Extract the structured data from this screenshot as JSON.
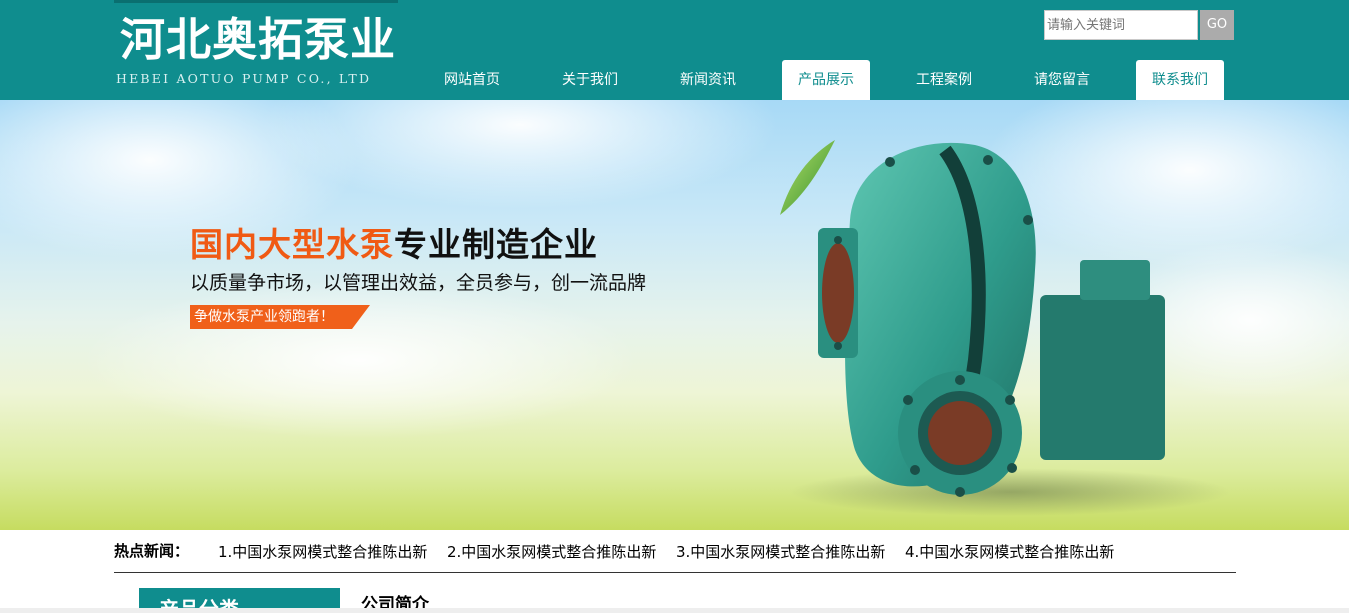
{
  "logo": {
    "title": "河北奥拓泵业",
    "subtitle": "HEBEI AOTUO PUMP CO., LTD"
  },
  "search": {
    "placeholder": "请输入关键词",
    "button_label": "GO"
  },
  "nav": {
    "items": [
      {
        "label": "网站首页",
        "active": false
      },
      {
        "label": "关于我们",
        "active": false
      },
      {
        "label": "新闻资讯",
        "active": false
      },
      {
        "label": "产品展示",
        "active": true
      },
      {
        "label": "工程案例",
        "active": false
      },
      {
        "label": "请您留言",
        "active": false
      },
      {
        "label": "联系我们",
        "active": true
      }
    ]
  },
  "banner": {
    "headline_accent": "国内大型水泵",
    "headline_rest": "专业制造企业",
    "slogan": "以质量争市场，以管理出效益，全员参与，创一流品牌",
    "tag": "争做水泵产业领跑者！"
  },
  "hot_news": {
    "label": "热点新闻：",
    "items": [
      "1.中国水泵网模式整合推陈出新",
      "2.中国水泵网模式整合推陈出新",
      "3.中国水泵网模式整合推陈出新",
      "4.中国水泵网模式整合推陈出新"
    ]
  },
  "sections": {
    "category_title": "产品分类",
    "intro_title": "公司简介"
  },
  "colors": {
    "primary": "#0f8d8e",
    "accent": "#f05a14",
    "search_button": "#ababab"
  }
}
